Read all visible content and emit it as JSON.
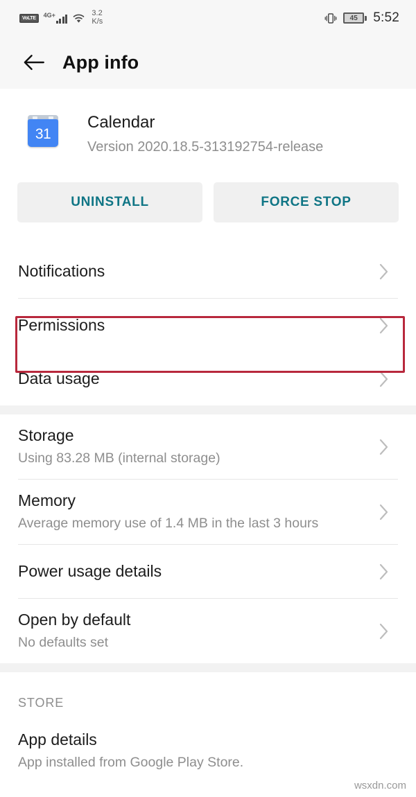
{
  "status_bar": {
    "volte_label": "VoLTE",
    "network_label": "4G+",
    "signal_bars": 4,
    "wifi_icon": "wifi-icon",
    "data_speed_value": "3.2",
    "data_speed_unit": "K/s",
    "vibrate_icon": "vibrate-icon",
    "battery_level": "45",
    "time": "5:52"
  },
  "app_bar": {
    "back_icon": "back-arrow-icon",
    "title": "App info"
  },
  "app_header": {
    "icon_name": "calendar-app-icon",
    "icon_day": "31",
    "app_name": "Calendar",
    "version": "Version 2020.18.5-313192754-release"
  },
  "actions": {
    "uninstall_label": "UNINSTALL",
    "force_stop_label": "FORCE STOP",
    "accent_color": "#0f7585",
    "button_bg": "#f0f0f0"
  },
  "highlight": {
    "target": "Permissions",
    "color": "#b8283c"
  },
  "groups": [
    {
      "rows": [
        {
          "title": "Notifications",
          "subtitle": "",
          "chevron": "chevron-right-icon"
        },
        {
          "title": "Permissions",
          "subtitle": "",
          "chevron": "chevron-right-icon"
        },
        {
          "title": "Data usage",
          "subtitle": "",
          "chevron": "chevron-right-icon"
        }
      ]
    },
    {
      "rows": [
        {
          "title": "Storage",
          "subtitle": "Using 83.28 MB (internal storage)",
          "chevron": "chevron-right-icon"
        },
        {
          "title": "Memory",
          "subtitle": "Average memory use of 1.4 MB in the last 3 hours",
          "chevron": "chevron-right-icon"
        },
        {
          "title": "Power usage details",
          "subtitle": "",
          "chevron": "chevron-right-icon"
        },
        {
          "title": "Open by default",
          "subtitle": "No defaults set",
          "chevron": "chevron-right-icon"
        }
      ]
    }
  ],
  "store_section": {
    "label": "STORE",
    "rows": [
      {
        "title": "App details",
        "subtitle": "App installed from Google Play Store."
      }
    ]
  },
  "watermark": "wsxdn.com"
}
